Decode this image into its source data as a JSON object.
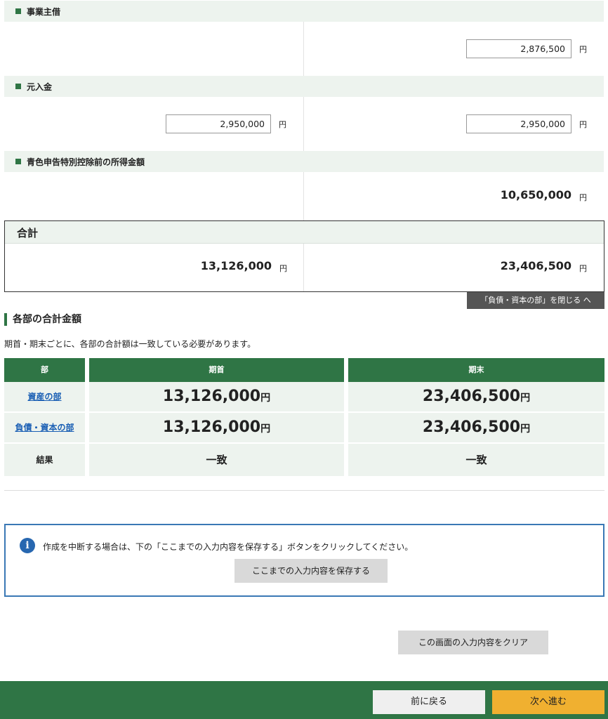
{
  "sections": {
    "jigyo_nushikari": {
      "title": "事業主借",
      "end_value": "2,876,500"
    },
    "motoire_kin": {
      "title": "元入金",
      "start_value": "2,950,000",
      "end_value": "2,950,000"
    },
    "shotoku": {
      "title": "青色申告特別控除前の所得金額",
      "end_value": "10,650,000"
    }
  },
  "yen_unit": "円",
  "total": {
    "title": "合計",
    "start_value": "13,126,000",
    "end_value": "23,406,500"
  },
  "close_tab_label": "「負債・資本の部」を閉じる へ",
  "summary": {
    "title": "各部の合計金額",
    "note": "期首・期末ごとに、各部の合計額は一致している必要があります。",
    "headers": [
      "部",
      "期首",
      "期末"
    ],
    "rows": [
      {
        "label": "資産の部",
        "start": "13,126,000",
        "end": "23,406,500"
      },
      {
        "label": "負債・資本の部",
        "start": "13,126,000",
        "end": "23,406,500"
      }
    ],
    "result": {
      "label": "結果",
      "start": "一致",
      "end": "一致"
    }
  },
  "info": {
    "icon_letter": "i",
    "text": "作成を中断する場合は、下の「ここまでの入力内容を保存する」ボタンをクリックしてください。",
    "save_button": "ここまでの入力内容を保存する"
  },
  "clear_button": "この画面の入力内容をクリア",
  "footer": {
    "back": "前に戻る",
    "next": "次へ進む"
  }
}
